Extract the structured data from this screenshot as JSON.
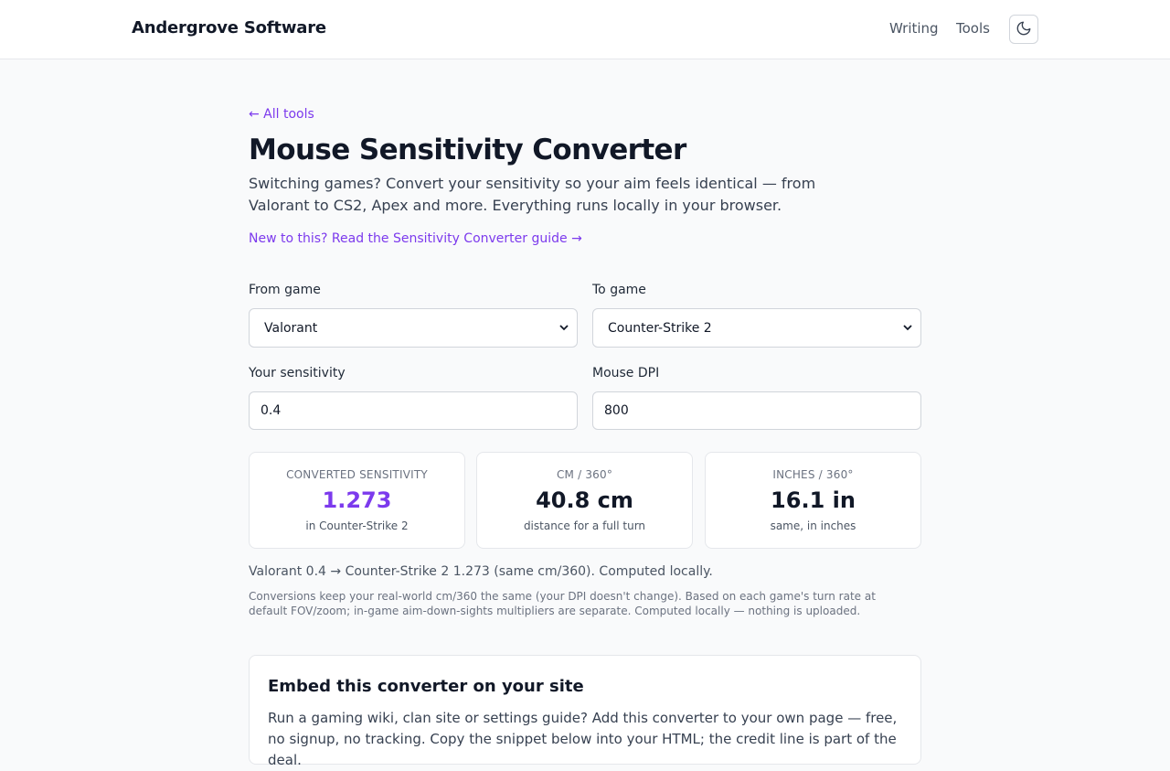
{
  "header": {
    "brand": "Andergrove Software",
    "nav": [
      "Writing",
      "Tools"
    ],
    "theme_toggle_icon": "moon-icon"
  },
  "page": {
    "back_link": "← All tools",
    "title": "Mouse Sensitivity Converter",
    "intro": "Switching games? Convert your sensitivity so your aim feels identical — from Valorant to CS2, Apex and more. Everything runs locally in your browser.",
    "guide_link": "New to this? Read the Sensitivity Converter guide →"
  },
  "form": {
    "from_label": "From game",
    "from_value": "Valorant",
    "to_label": "To game",
    "to_value": "Counter-Strike 2",
    "sens_label": "Your sensitivity",
    "sens_value": "0.4",
    "dpi_label": "Mouse DPI",
    "dpi_value": "800"
  },
  "results": [
    {
      "label": "CONVERTED SENSITIVITY",
      "value": "1.273",
      "sub": "in Counter-Strike 2"
    },
    {
      "label": "CM / 360°",
      "value": "40.8 cm",
      "sub": "distance for a full turn"
    },
    {
      "label": "INCHES / 360°",
      "value": "16.1 in",
      "sub": "same, in inches"
    }
  ],
  "summary": "Valorant 0.4 → Counter-Strike 2 1.273 (same cm/360). Computed locally.",
  "note": "Conversions keep your real-world cm/360 the same (your DPI doesn't change). Based on each game's turn rate at default FOV/zoom; in-game aim-down-sights multipliers are separate. Computed locally — nothing is uploaded.",
  "embed": {
    "title": "Embed this converter on your site",
    "text": "Run a gaming wiki, clan site or settings guide? Add this converter to your own page — free, no signup, no tracking. Copy the snippet below into your HTML; the credit line is part of the deal."
  },
  "colors": {
    "accent": "#7c3aed",
    "text": "#111827",
    "background": "#f9fafb"
  }
}
